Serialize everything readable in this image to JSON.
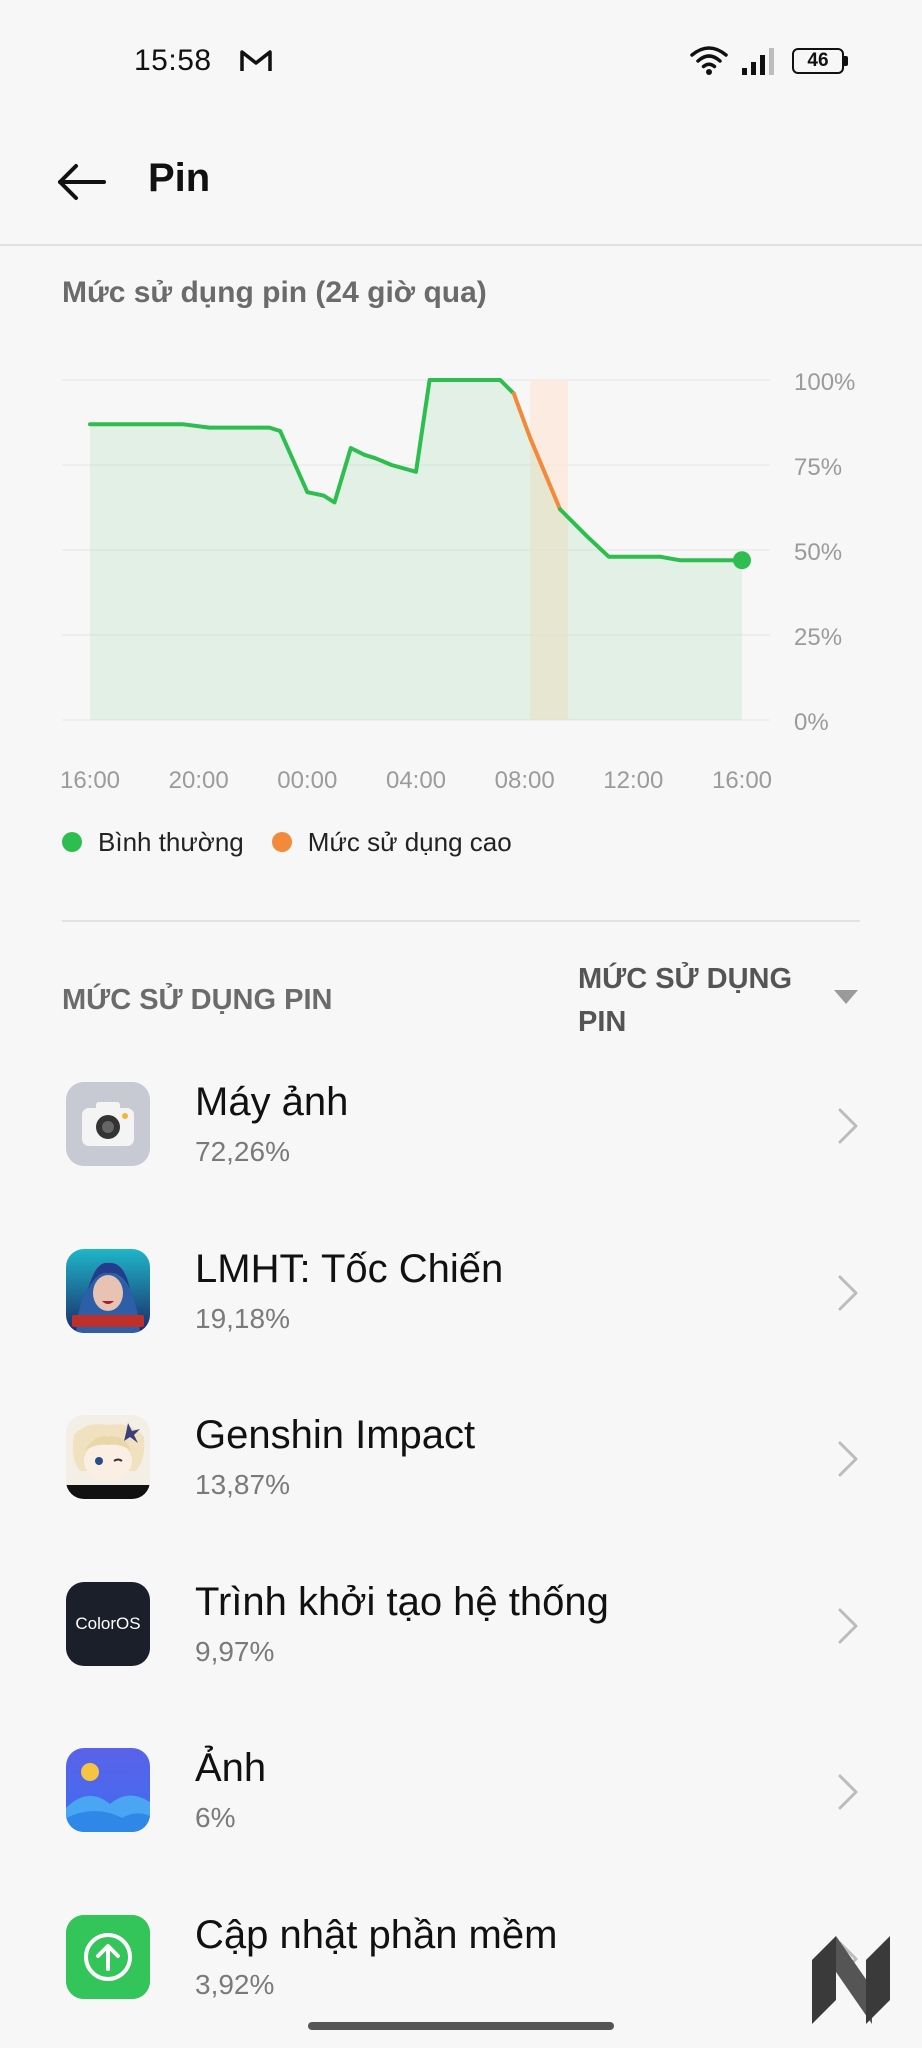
{
  "status_bar": {
    "time": "15:58",
    "battery_level": "46",
    "icons": [
      "gmail-icon",
      "wifi-icon",
      "signal-icon",
      "battery-icon"
    ]
  },
  "header": {
    "title": "Pin",
    "back_icon": "arrow-left-icon"
  },
  "chart_section": {
    "title": "Mức sử dụng pin (24 giờ qua)"
  },
  "chart_data": {
    "type": "area",
    "x_tick_labels": [
      "16:00",
      "20:00",
      "00:00",
      "04:00",
      "08:00",
      "12:00",
      "16:00"
    ],
    "y_tick_labels": [
      "100%",
      "75%",
      "50%",
      "25%",
      "0%"
    ],
    "ylim": [
      0,
      100
    ],
    "x_range_hours": [
      0,
      24
    ],
    "grid": true,
    "legend_position": "bottom-left",
    "series": [
      {
        "name": "Bình thường",
        "color": "#2dbe4f",
        "points": [
          [
            0,
            87
          ],
          [
            3.4,
            87
          ],
          [
            4.4,
            86
          ],
          [
            6.6,
            86
          ],
          [
            7.0,
            85
          ],
          [
            8.0,
            67
          ],
          [
            8.6,
            66
          ],
          [
            9.0,
            64
          ],
          [
            9.6,
            80
          ],
          [
            10.1,
            78
          ],
          [
            10.5,
            77
          ],
          [
            11.1,
            75
          ],
          [
            12.0,
            73
          ],
          [
            12.5,
            100
          ],
          [
            15.1,
            100
          ],
          [
            15.6,
            96
          ]
        ]
      },
      {
        "name": "Mức sử dụng cao",
        "color": "#f3893a",
        "points": [
          [
            15.6,
            96
          ],
          [
            16.2,
            83
          ],
          [
            17.3,
            62
          ]
        ]
      },
      {
        "name": "Bình thường",
        "color": "#2dbe4f",
        "points": [
          [
            17.3,
            62
          ],
          [
            18.3,
            54
          ],
          [
            19.1,
            48
          ],
          [
            21.0,
            48
          ],
          [
            21.7,
            47
          ],
          [
            24.0,
            47
          ]
        ]
      }
    ],
    "high_usage_band_hours": [
      16.2,
      17.6
    ],
    "current_value": 47
  },
  "legend": {
    "items": [
      {
        "label": "Bình thường",
        "color": "#2dbe4f"
      },
      {
        "label": "Mức sử dụng cao",
        "color": "#f3893a"
      }
    ]
  },
  "usage_section": {
    "label": "MỨC SỬ DỤNG PIN",
    "sort_value": "MỨC SỬ DỤNG PIN"
  },
  "apps": [
    {
      "name": "Máy ảnh",
      "usage": "72,26%",
      "icon": "camera-app-icon"
    },
    {
      "name": "LMHT: Tốc Chiến",
      "usage": "19,18%",
      "icon": "wild-rift-app-icon"
    },
    {
      "name": "Genshin Impact",
      "usage": "13,87%",
      "icon": "genshin-app-icon"
    },
    {
      "name": "Trình khởi tạo hệ thống",
      "usage": "9,97%",
      "icon": "coloros-app-icon",
      "icon_text": "ColorOS"
    },
    {
      "name": "Ảnh",
      "usage": "6%",
      "icon": "photos-app-icon"
    },
    {
      "name": "Cập nhật phần mềm",
      "usage": "3,92%",
      "icon": "software-update-app-icon"
    }
  ],
  "colors": {
    "normal": "#2dbe4f",
    "high": "#f3893a",
    "background": "#f7f7f7"
  }
}
